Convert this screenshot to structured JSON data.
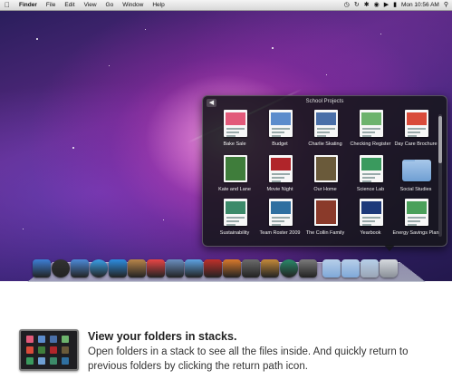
{
  "menubar": {
    "items": [
      "Finder",
      "File",
      "Edit",
      "View",
      "Go",
      "Window",
      "Help"
    ],
    "clock": "Mon 10:56 AM"
  },
  "stack": {
    "title": "School Projects",
    "items": [
      {
        "label": "Bake Sale",
        "kind": "doc",
        "color": "#e25a7a"
      },
      {
        "label": "Budget",
        "kind": "doc",
        "color": "#5c8ccc"
      },
      {
        "label": "Charlie Skating",
        "kind": "doc",
        "color": "#4a6fa8"
      },
      {
        "label": "Checking Register",
        "kind": "doc",
        "color": "#6db36d"
      },
      {
        "label": "Day Care Brochure",
        "kind": "doc",
        "color": "#d94b3a"
      },
      {
        "label": "Kate and Lane",
        "kind": "photo",
        "color": "#3f7d3b"
      },
      {
        "label": "Movie Night",
        "kind": "doc",
        "color": "#b0252a"
      },
      {
        "label": "Our Home",
        "kind": "photo",
        "color": "#6a5a3a"
      },
      {
        "label": "Science Lab",
        "kind": "doc",
        "color": "#3a9a5e"
      },
      {
        "label": "Social Studies",
        "kind": "folder",
        "color": "#6f9fd3"
      },
      {
        "label": "Sustainability",
        "kind": "doc",
        "color": "#3c8a6a"
      },
      {
        "label": "Team Roster 2009",
        "kind": "doc",
        "color": "#2f6fa0"
      },
      {
        "label": "The Collin Family",
        "kind": "photo",
        "color": "#8a3a2a"
      },
      {
        "label": "Yearbook",
        "kind": "doc",
        "color": "#1e3a7a"
      },
      {
        "label": "Energy Savings Plan",
        "kind": "doc",
        "color": "#4aa05a"
      }
    ]
  },
  "dock_icons": [
    {
      "name": "finder-icon",
      "color": "#3d7fd6"
    },
    {
      "name": "dashboard-icon",
      "color": "#333333"
    },
    {
      "name": "mail-icon",
      "color": "#4c8ad8"
    },
    {
      "name": "safari-icon",
      "color": "#3aa0e8"
    },
    {
      "name": "ichat-icon",
      "color": "#2d8de0"
    },
    {
      "name": "address-book-icon",
      "color": "#b8864a"
    },
    {
      "name": "ical-icon",
      "color": "#e84545"
    },
    {
      "name": "preview-icon",
      "color": "#6a8fc0"
    },
    {
      "name": "itunes-icon",
      "color": "#5da3e3"
    },
    {
      "name": "photo-booth-icon",
      "color": "#c0302a"
    },
    {
      "name": "iphoto-icon",
      "color": "#d97a2c"
    },
    {
      "name": "imovie-icon",
      "color": "#6b6b6b"
    },
    {
      "name": "garageband-icon",
      "color": "#c48a3a"
    },
    {
      "name": "time-machine-icon",
      "color": "#2a8a6a"
    },
    {
      "name": "system-preferences-icon",
      "color": "#7b7b7b"
    },
    {
      "name": "applications-folder-icon",
      "color": "#7fa8d8"
    },
    {
      "name": "documents-folder-icon",
      "color": "#7fa8d8"
    },
    {
      "name": "school-projects-stack-icon",
      "color": "#9aa5b5"
    },
    {
      "name": "trash-icon",
      "color": "#9aa0a8"
    }
  ],
  "caption": {
    "title": "View your folders in stacks.",
    "body": "Open folders in a stack to see all the files inside. And quickly return to previous folders by clicking the return path icon."
  }
}
